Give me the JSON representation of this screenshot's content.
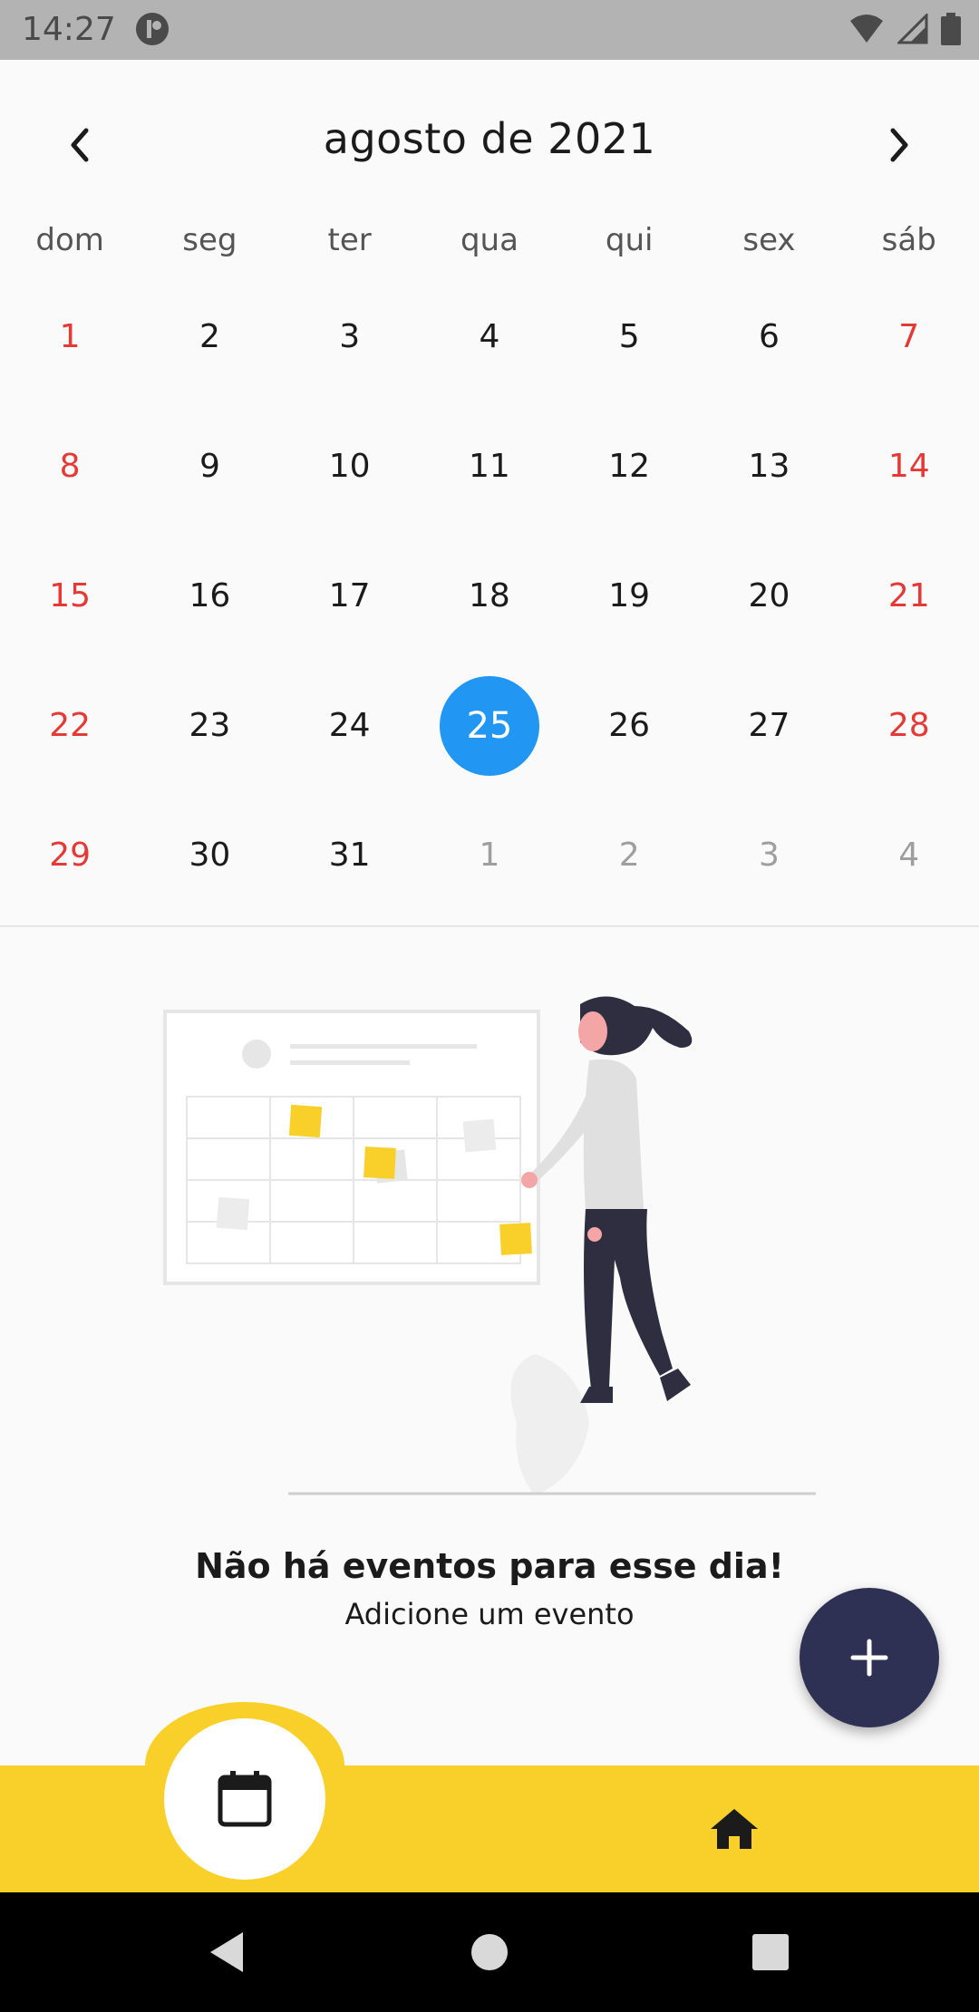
{
  "status_bar": {
    "time": "14:27"
  },
  "calendar": {
    "month_title": "agosto de 2021",
    "weekdays": [
      "dom",
      "seg",
      "ter",
      "qua",
      "qui",
      "sex",
      "sáb"
    ],
    "weeks": [
      [
        "1",
        "2",
        "3",
        "4",
        "5",
        "6",
        "7"
      ],
      [
        "8",
        "9",
        "10",
        "11",
        "12",
        "13",
        "14"
      ],
      [
        "15",
        "16",
        "17",
        "18",
        "19",
        "20",
        "21"
      ],
      [
        "22",
        "23",
        "24",
        "25",
        "26",
        "27",
        "28"
      ],
      [
        "29",
        "30",
        "31",
        "1",
        "2",
        "3",
        "4"
      ]
    ],
    "selected_day": "25",
    "colors": {
      "weekend": "#e53935",
      "selected": "#2196f3",
      "other_month": "#9e9e9e"
    }
  },
  "empty_state": {
    "title": "Não há eventos para esse dia!",
    "subtitle": "Adicione um evento"
  },
  "fab": {
    "icon": "plus-icon",
    "color": "#2e3153"
  },
  "bottom_nav": {
    "color": "#f9d02a",
    "items": [
      {
        "icon": "calendar-icon",
        "active": true
      },
      {
        "icon": "home-icon",
        "active": false
      }
    ]
  }
}
